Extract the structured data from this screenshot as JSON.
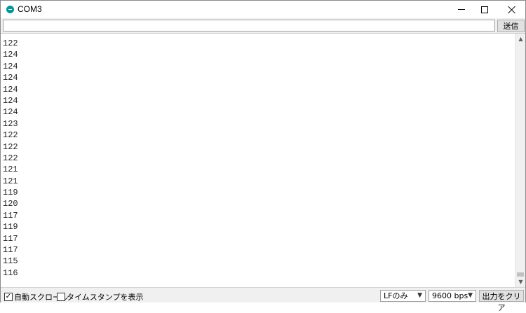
{
  "window": {
    "title": "COM3",
    "icon": "arduino-icon"
  },
  "send": {
    "input_value": "",
    "button_label": "送信"
  },
  "output": {
    "lines": [
      "122",
      "124",
      "124",
      "124",
      "124",
      "124",
      "124",
      "123",
      "122",
      "122",
      "122",
      "121",
      "121",
      "119",
      "120",
      "117",
      "119",
      "117",
      "117",
      "115",
      "116"
    ]
  },
  "statusbar": {
    "autoscroll_label": "自動スクロール",
    "autoscroll_checked": true,
    "timestamp_label": "タイムスタンプを表示",
    "timestamp_checked": false,
    "line_ending": "LFのみ",
    "baud_rate": "9600 bps",
    "clear_label": "出力をクリア"
  }
}
